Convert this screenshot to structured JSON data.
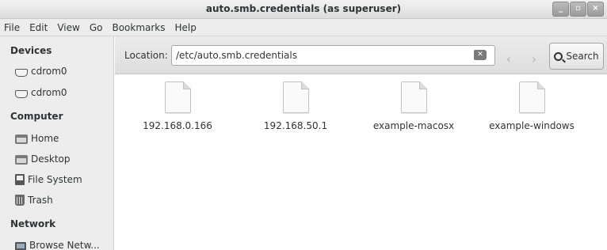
{
  "window": {
    "title": "auto.smb.credentials (as superuser)",
    "controls": [
      "_",
      "▫",
      "×"
    ]
  },
  "menubar": [
    "File",
    "Edit",
    "View",
    "Go",
    "Bookmarks",
    "Help"
  ],
  "sidebar": {
    "devices_heading": "Devices",
    "devices": [
      {
        "label": "cdrom0",
        "icon": "drive-icon"
      },
      {
        "label": "cdrom0",
        "icon": "drive-icon"
      }
    ],
    "computer_heading": "Computer",
    "computer": [
      {
        "label": "Home",
        "icon": "home-folder-icon"
      },
      {
        "label": "Desktop",
        "icon": "desktop-folder-icon"
      },
      {
        "label": "File System",
        "icon": "file-system-icon"
      },
      {
        "label": "Trash",
        "icon": "trash-icon"
      }
    ],
    "network_heading": "Network",
    "network": [
      {
        "label": "Browse Netw...",
        "icon": "network-icon"
      }
    ]
  },
  "toolbar": {
    "location_label": "Location:",
    "location_value": "/etc/auto.smb.credentials",
    "back_glyph": "‹",
    "forward_glyph": "›",
    "search_label": "Search"
  },
  "files": [
    {
      "name": "192.168.0.166",
      "icon": "text-file-icon"
    },
    {
      "name": "192.168.50.1",
      "icon": "text-file-icon"
    },
    {
      "name": "example-macosx",
      "icon": "text-file-icon"
    },
    {
      "name": "example-windows",
      "icon": "text-file-icon"
    }
  ]
}
